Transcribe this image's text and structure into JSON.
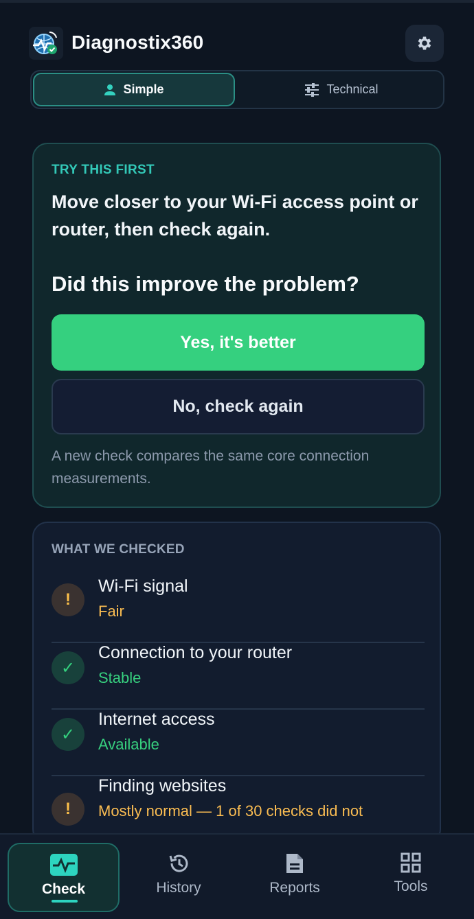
{
  "app": {
    "title": "Diagnostix360",
    "logo_icon": "network-check-logo",
    "settings_icon": "gear-icon"
  },
  "mode_toggle": {
    "simple_label": "Simple",
    "technical_label": "Technical",
    "selected": "Simple"
  },
  "try_card": {
    "eyebrow": "TRY THIS FIRST",
    "instruction": "Move closer to your Wi-Fi access point or router, then check again.",
    "question": "Did this improve the problem?",
    "yes_label": "Yes, it's better",
    "no_label": "No, check again",
    "hint": "A new check compares the same core connection measurements."
  },
  "checked_card": {
    "eyebrow": "WHAT WE CHECKED",
    "items": [
      {
        "title": "Wi-Fi signal",
        "status": "Fair",
        "level": "warning",
        "icon": "!"
      },
      {
        "title": "Connection to your router",
        "status": "Stable",
        "level": "ok",
        "icon": "✓"
      },
      {
        "title": "Internet access",
        "status": "Available",
        "level": "ok",
        "icon": "✓"
      },
      {
        "title": "Finding websites",
        "status": "Mostly normal — 1 of 30 checks did not",
        "level": "warning",
        "icon": "!"
      }
    ]
  },
  "bottom_nav": {
    "items": [
      {
        "label": "Check",
        "icon": "pulse-icon",
        "active": true
      },
      {
        "label": "History",
        "icon": "history-icon",
        "active": false
      },
      {
        "label": "Reports",
        "icon": "document-icon",
        "active": false
      },
      {
        "label": "Tools",
        "icon": "grid-icon",
        "active": false
      }
    ]
  },
  "colors": {
    "background": "#0d1521",
    "accent": "#2dd4bf",
    "success": "#35d07f",
    "warning": "#fbbf4a"
  }
}
